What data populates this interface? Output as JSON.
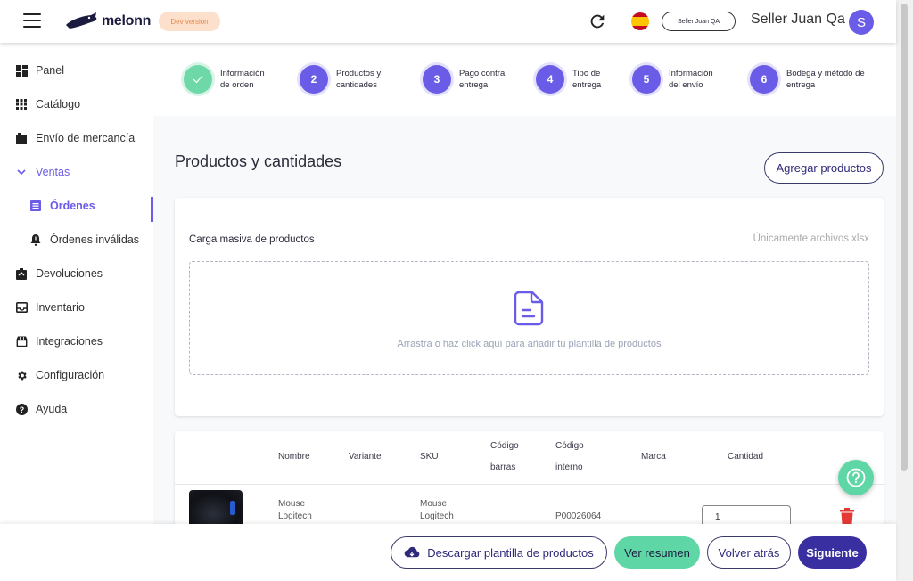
{
  "header": {
    "logo_text": "melonn",
    "env_badge": "Dev version",
    "seller_chip": "Seller Juan QA",
    "seller_name": "Seller Juan Qa",
    "avatar_initial": "S"
  },
  "sidebar": {
    "items": [
      {
        "label": "Panel",
        "icon": "dashboard-icon"
      },
      {
        "label": "Catálogo",
        "icon": "grid-icon"
      },
      {
        "label": "Envío de mercancía",
        "icon": "box-icon"
      },
      {
        "label": "Ventas",
        "icon": "chevron-down-icon",
        "expanded": true
      },
      {
        "label": "Órdenes",
        "icon": "list-icon",
        "active": true
      },
      {
        "label": "Órdenes inválidas",
        "icon": "alert-bell-icon"
      },
      {
        "label": "Devoluciones",
        "icon": "return-icon"
      },
      {
        "label": "Inventario",
        "icon": "inbox-icon"
      },
      {
        "label": "Integraciones",
        "icon": "store-icon"
      },
      {
        "label": "Configuración",
        "icon": "gear-icon"
      },
      {
        "label": "Ayuda",
        "icon": "help-icon"
      }
    ]
  },
  "stepper": {
    "steps": [
      {
        "number": "✓",
        "label": "Información\nde orden",
        "done": true
      },
      {
        "number": "2",
        "label": "Productos y\ncantidades"
      },
      {
        "number": "3",
        "label": "Pago contra\nentrega"
      },
      {
        "number": "4",
        "label": "Tipo de\nentrega"
      },
      {
        "number": "5",
        "label": "Información\ndel envío"
      },
      {
        "number": "6",
        "label": "Bodega y método de\nentrega"
      }
    ]
  },
  "main": {
    "title": "Productos y cantidades",
    "add_products_label": "Agregar productos"
  },
  "upload": {
    "title": "Carga masiva de productos",
    "hint": "Únicamente archivos xlsx",
    "drop_text": "Arrastra o haz click aquí para añadir tu plantilla de productos"
  },
  "table": {
    "headers": {
      "name": "Nombre",
      "variant": "Variante",
      "sku": "SKU",
      "barcode_1": "Código",
      "barcode_2": "barras",
      "internal_1": "Código",
      "internal_2": "interno",
      "brand": "Marca",
      "quantity": "Cantidad"
    },
    "rows": [
      {
        "name_1": "Mouse",
        "name_2": "Logitech",
        "sku_1": "Mouse",
        "sku_2": "Logitech",
        "internal_code": "P00026064",
        "quantity": "1"
      }
    ]
  },
  "footer": {
    "download_label": "Descargar plantilla de productos",
    "summary_label": "Ver resumen",
    "back_label": "Volver atrás",
    "next_label": "Siguiente"
  },
  "colors": {
    "primary": "#6b5ce7",
    "accent_green": "#5fd6a5",
    "dark_button": "#3a2fa0",
    "danger": "#e53935"
  }
}
